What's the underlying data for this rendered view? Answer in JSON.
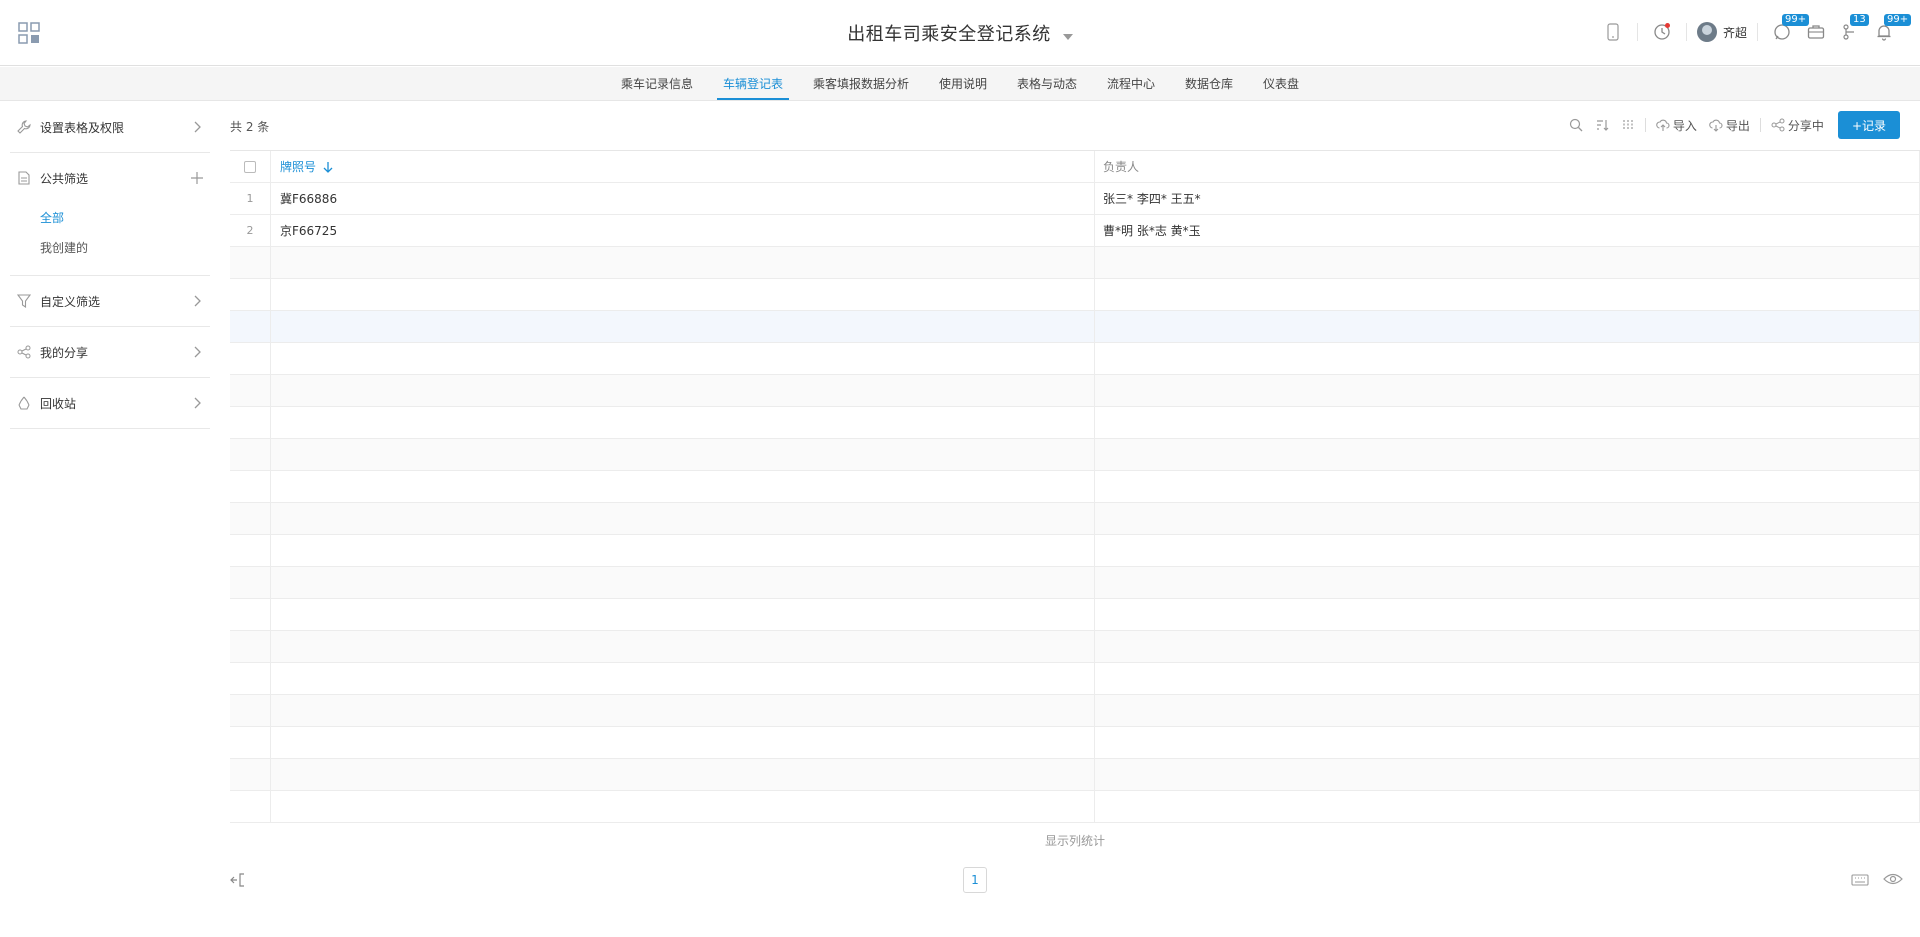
{
  "header": {
    "title": "出租车司乘安全登记系统",
    "user_name": "齐超",
    "badges": {
      "chat": "99+",
      "todo": "13",
      "notify": "99+"
    }
  },
  "tabs": [
    {
      "label": "乘车记录信息",
      "active": false
    },
    {
      "label": "车辆登记表",
      "active": true
    },
    {
      "label": "乘客填报数据分析",
      "active": false
    },
    {
      "label": "使用说明",
      "active": false
    },
    {
      "label": "表格与动态",
      "active": false
    },
    {
      "label": "流程中心",
      "active": false
    },
    {
      "label": "数据仓库",
      "active": false
    },
    {
      "label": "仪表盘",
      "active": false
    }
  ],
  "sidebar": {
    "settings": "设置表格及权限",
    "public_filter": "公共筛选",
    "filter_items": [
      "全部",
      "我创建的"
    ],
    "custom_filter": "自定义筛选",
    "my_share": "我的分享",
    "recycle": "回收站"
  },
  "content": {
    "count_text": "共 2 条",
    "toolbar": {
      "import": "导入",
      "export": "导出",
      "share": "分享中",
      "add": "+记录"
    },
    "columns": [
      "牌照号",
      "负责人"
    ],
    "rows": [
      {
        "idx": "1",
        "plate": "冀F66886",
        "owner": "张三* 李四* 王五*"
      },
      {
        "idx": "2",
        "plate": "京F66725",
        "owner": "曹*明 张*志 黄*玉"
      }
    ],
    "stats_label": "显示列统计",
    "page": "1"
  },
  "colors": {
    "accent": "#1b8fd6",
    "badge": "#1b8fd6",
    "dot": "#e53935"
  },
  "icons": [
    "apps-icon",
    "mobile-icon",
    "clock-icon",
    "chat-icon",
    "briefcase-icon",
    "flow-icon",
    "bell-icon",
    "search-icon",
    "sort-icon",
    "columns-icon",
    "upload-icon",
    "download-icon",
    "share-icon",
    "keyboard-icon",
    "eye-icon"
  ]
}
